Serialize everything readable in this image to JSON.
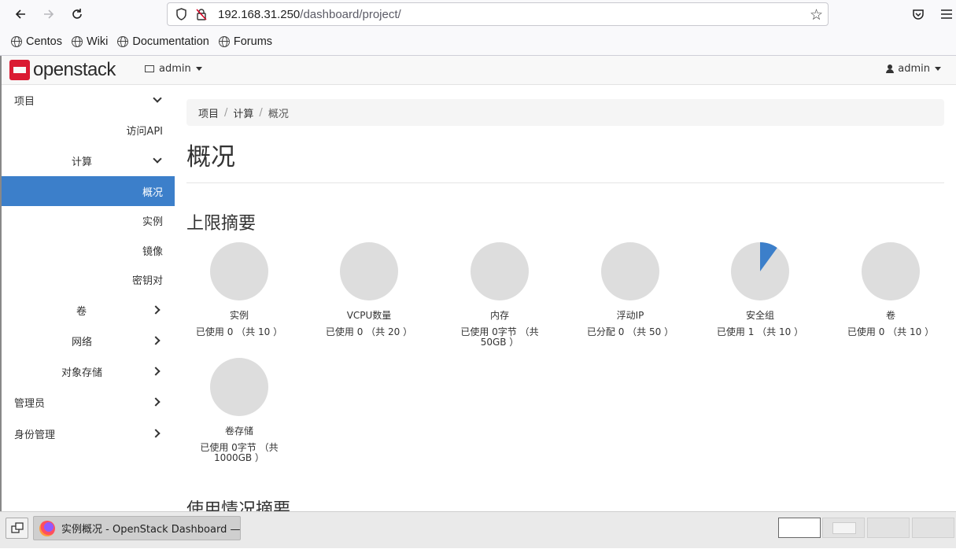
{
  "browser": {
    "url_host": "192.168.31.250",
    "url_path": "/dashboard/project/",
    "bookmarks": [
      "Centos",
      "Wiki",
      "Documentation",
      "Forums"
    ]
  },
  "header": {
    "logo_text": "openstack",
    "project_name": "admin",
    "user_name": "admin"
  },
  "sidebar": {
    "items": [
      {
        "label": "项目"
      },
      {
        "label": "访问API"
      },
      {
        "label": "计算"
      },
      {
        "label": "概况"
      },
      {
        "label": "实例"
      },
      {
        "label": "镜像"
      },
      {
        "label": "密钥对"
      },
      {
        "label": "卷"
      },
      {
        "label": "网络"
      },
      {
        "label": "对象存储"
      },
      {
        "label": "管理员"
      },
      {
        "label": "身份管理"
      }
    ]
  },
  "breadcrumb": [
    "项目",
    "计算",
    "概况"
  ],
  "page": {
    "title": "概况",
    "limits_heading": "上限摘要",
    "usage_heading": "使用情况摘要"
  },
  "limits": [
    {
      "title": "实例",
      "text": "已使用 0 （共 10 ）",
      "fraction": 0.0
    },
    {
      "title": "VCPU数量",
      "text": "已使用 0 （共 20 ）",
      "fraction": 0.0
    },
    {
      "title": "内存",
      "text": "已使用 0字节 （共 50GB ）",
      "fraction": 0.0
    },
    {
      "title": "浮动IP",
      "text": "已分配 0 （共 50 ）",
      "fraction": 0.0
    },
    {
      "title": "安全组",
      "text": "已使用 1 （共 10 ）",
      "fraction": 0.1
    },
    {
      "title": "卷",
      "text": "已使用 0 （共 10 ）",
      "fraction": 0.0
    },
    {
      "title": "卷存储",
      "text": "已使用 0字节 （共 1000GB ）",
      "fraction": 0.0
    }
  ],
  "taskbar": {
    "window_title": "实例概况 - OpenStack Dashboard —..."
  },
  "colors": {
    "accent": "#3c7fca",
    "pie_empty": "#dddddd",
    "pie_used": "#3c7fca",
    "brand_red": "#da1a32"
  }
}
